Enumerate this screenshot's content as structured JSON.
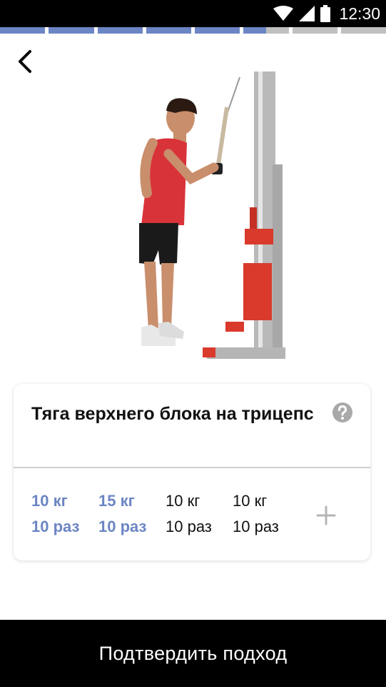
{
  "status_bar": {
    "time": "12:30",
    "icons": [
      "wifi-icon",
      "signal-icon",
      "battery-icon"
    ]
  },
  "progress": {
    "total_segments": 8,
    "completed_segments": 5.5,
    "active_color": "#6c85c4",
    "inactive_color": "#c0c0c0"
  },
  "exercise": {
    "title": "Тяга верхнего блока на трицепс",
    "image_icon": "cable-triceps-pushdown-photo"
  },
  "sets": [
    {
      "weight": "10 кг",
      "reps": "10 раз",
      "done": true
    },
    {
      "weight": "15 кг",
      "reps": "10 раз",
      "done": true
    },
    {
      "weight": "10 кг",
      "reps": "10 раз",
      "done": false
    },
    {
      "weight": "10 кг",
      "reps": "10 раз",
      "done": false
    }
  ],
  "actions": {
    "confirm_label": "Подтвердить подход"
  }
}
